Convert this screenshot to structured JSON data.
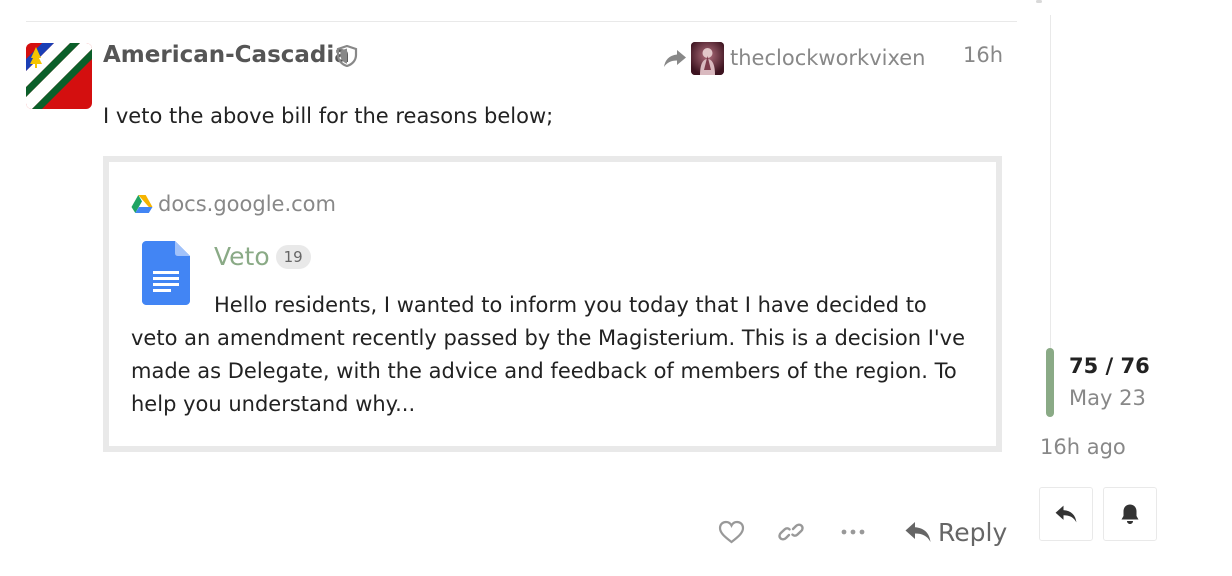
{
  "post": {
    "username": "American-Cascadia",
    "reply_to": "theclockworkvixen",
    "date": "16h",
    "body": "I veto the above bill for the reasons below;"
  },
  "onebox": {
    "domain": "docs.google.com",
    "title": "Veto",
    "clicks": "19",
    "excerpt": "Hello residents, I wanted to inform you today that I have decided to veto an amendment recently passed by the Magisterium. This is a decision I've made as Delegate, with the advice and feedback of members of the region. To help you understand why..."
  },
  "actions": {
    "reply_label": "Reply"
  },
  "timeline": {
    "count": "75 / 76",
    "date": "May 23",
    "ago": "16h ago",
    "position_fraction": 0.987
  },
  "icons": {
    "moderator": "shield-icon",
    "reply_to": "reply-arrow-icon",
    "drive": "google-drive-icon",
    "doc": "google-docs-icon",
    "like": "heart-icon",
    "link": "link-icon",
    "more": "ellipsis-icon",
    "reply": "reply-icon",
    "notify": "bell-icon"
  },
  "colors": {
    "accent": "#8aaa86",
    "muted_text": "#888888",
    "border": "#e9e9e9"
  }
}
